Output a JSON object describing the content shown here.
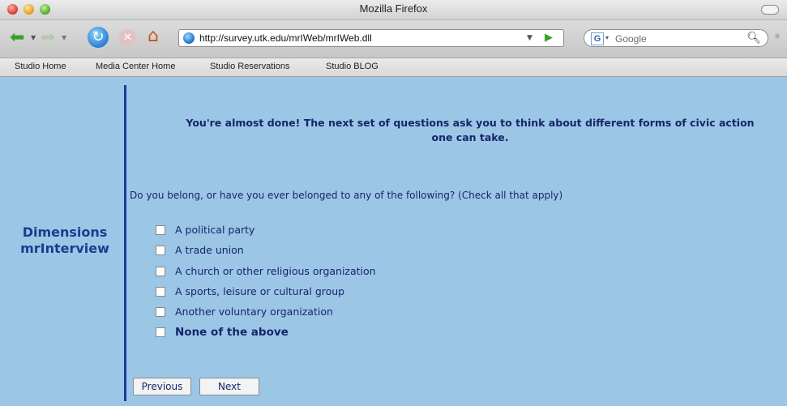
{
  "window": {
    "title": "Mozilla Firefox"
  },
  "toolbar": {
    "url": "http://survey.utk.edu/mrIWeb/mrIWeb.dll",
    "search_placeholder": "Google"
  },
  "bookmarks": [
    {
      "label": "Studio Home"
    },
    {
      "label": "Media Center Home"
    },
    {
      "label": "Studio Reservations"
    },
    {
      "label": "Studio BLOG"
    }
  ],
  "page": {
    "brand_line1": "Dimensions",
    "brand_line2": "mrInterview",
    "heading_line1": "You're almost done! The next set of questions ask you to think about different forms of civic action",
    "heading_line2": "one can take.",
    "question": "Do you belong, or have you ever belonged to any of the following? (Check all that apply)",
    "options": [
      {
        "label": "A political party",
        "checked": false
      },
      {
        "label": "A trade union",
        "checked": false
      },
      {
        "label": "A church or other religious organization",
        "checked": false
      },
      {
        "label": "A sports, leisure or cultural group",
        "checked": false
      },
      {
        "label": "Another voluntary organization",
        "checked": false
      },
      {
        "label": "None of the above",
        "checked": false
      }
    ],
    "buttons": {
      "previous": "Previous",
      "next": "Next"
    }
  },
  "colors": {
    "page_background": "#9cc6e6",
    "brand_text": "#1b3c8e",
    "divider": "#1b3a9e",
    "body_text": "#15256a"
  },
  "icons": {
    "back": "back-arrow-icon",
    "forward": "forward-arrow-icon",
    "reload": "reload-icon",
    "stop": "stop-icon",
    "home": "home-icon",
    "site": "globe-icon",
    "search_engine": "google-icon",
    "search": "magnifier-icon"
  }
}
